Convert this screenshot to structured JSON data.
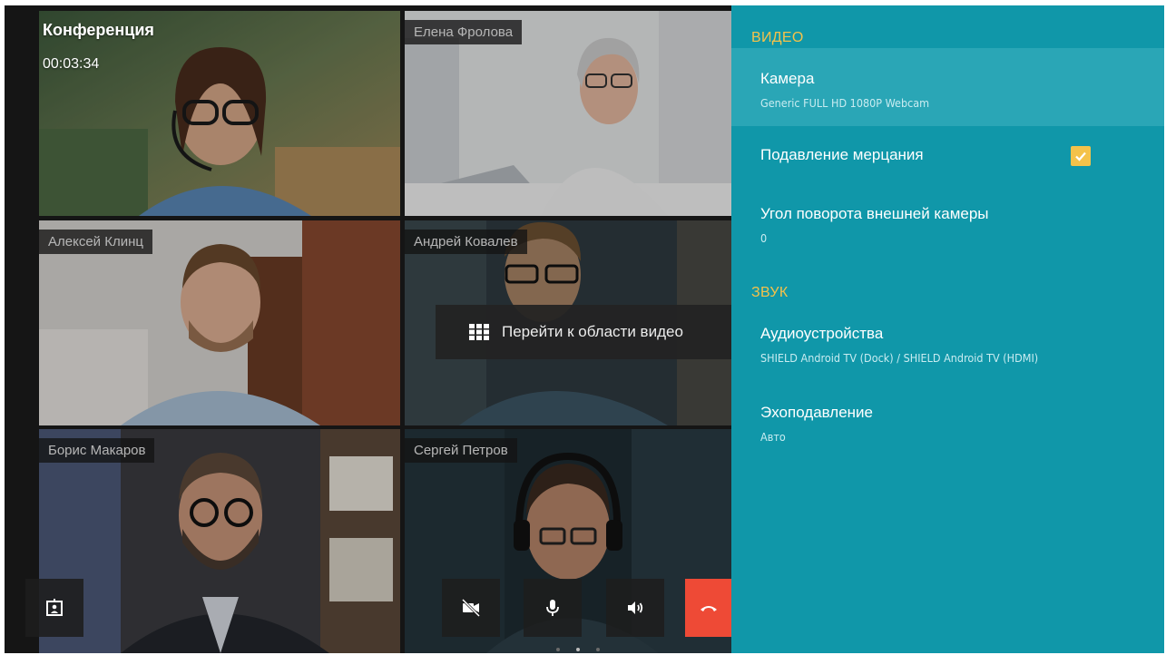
{
  "conference": {
    "title": "Конференция",
    "timer": "00:03:34"
  },
  "participants": [
    {
      "name": ""
    },
    {
      "name": "Елена Фролова"
    },
    {
      "name": "Алексей Клинц"
    },
    {
      "name": "Андрей Ковалев"
    },
    {
      "name": "Борис Макаров"
    },
    {
      "name": "Сергей Петров"
    }
  ],
  "overlay": {
    "goto_video_label": "Перейти к области видео",
    "icon": "grid-icon"
  },
  "controls": {
    "share_icon": "presentation-icon",
    "camera_icon": "camera-off-icon",
    "mic_icon": "microphone-icon",
    "speaker_icon": "speaker-icon",
    "hangup_icon": "hangup-icon",
    "hangup_color": "#ee4a36"
  },
  "settings": {
    "video_header": "ВИДЕО",
    "camera_title": "Камера",
    "camera_value": "Generic FULL HD 1080P Webcam",
    "flicker_title": "Подавление мерцания",
    "flicker_checked": true,
    "rotation_title": "Угол поворота внешней камеры",
    "rotation_value": "0",
    "sound_header": "ЗВУК",
    "audio_title": "Аудиоустройства",
    "audio_value": "SHIELD Android TV (Dock) / SHIELD Android TV (HDMI)",
    "echo_title": "Эхоподавление",
    "echo_value": "Авто",
    "panel_color": "#1097a9",
    "accent_color": "#f4c24a"
  },
  "pagination": {
    "pages": 3,
    "active": 2
  }
}
